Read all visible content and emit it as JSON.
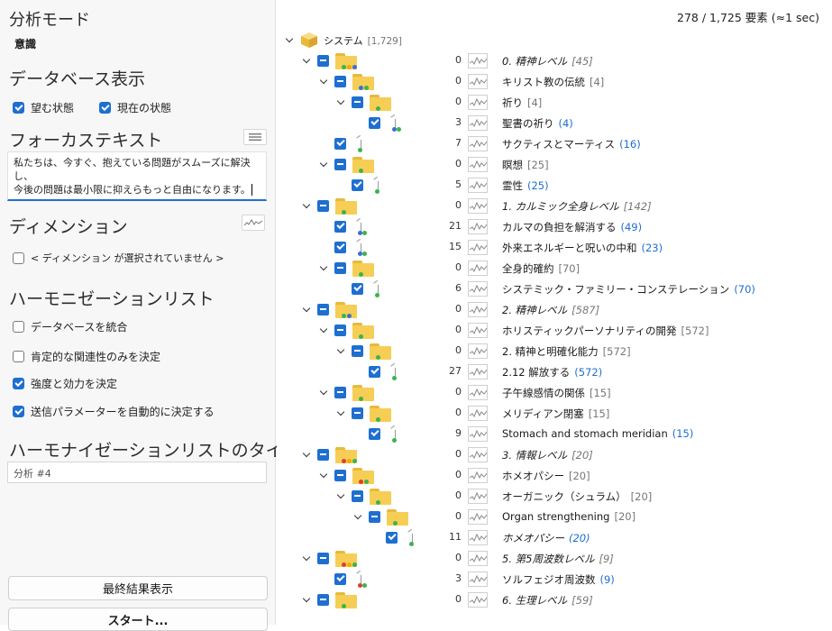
{
  "status": "278 / 1,725 要素 (≈1 sec)",
  "left": {
    "analysis_mode_title": "分析モード",
    "analysis_mode_value": "意識",
    "db_display_title": "データベース表示",
    "desired_state": "望む状態",
    "current_state": "現在の状態",
    "focus_text_title": "フォーカステキスト",
    "focus_text_line1": "私たちは、今すぐ、抱えている問題がスムーズに解決し、",
    "focus_text_line2": "今後の問題は最小限に抑えらもっと自由になります。",
    "dimension_title": "ディメンション",
    "dimension_none": "< ディメンション が選択されていません >",
    "harmonization_title": "ハーモニゼーションリスト",
    "opt_integrate": "データベースを統合",
    "opt_positive_only": "肯定的な関連性のみを決定",
    "opt_strength": "強度と効力を決定",
    "opt_auto_params": "送信パラメーターを自動的に決定する",
    "list_title_label": "ハーモナイゼーションリストのタイトル",
    "list_title_value": "分析 #4",
    "show_results_button": "最終結果表示",
    "start_button": "スタート..."
  },
  "tree": {
    "rows": [
      {
        "label": "システム",
        "count": "[1,729]",
        "num": "",
        "type": "root"
      },
      {
        "label": "0. 精神レベル",
        "count": "[45]",
        "num": "0",
        "italic": true
      },
      {
        "label": "キリスト教の伝統",
        "count": "[4]",
        "num": "0"
      },
      {
        "label": "祈り",
        "count": "[4]",
        "num": "0"
      },
      {
        "label": "聖書の祈り",
        "count": "(4)",
        "num": "3"
      },
      {
        "label": "サクティスとマーティス",
        "count": "(16)",
        "num": "7"
      },
      {
        "label": "瞑想",
        "count": "[25]",
        "num": "0"
      },
      {
        "label": "霊性",
        "count": "(25)",
        "num": "5"
      },
      {
        "label": "1. カルミック全身レベル",
        "count": "[142]",
        "num": "0",
        "italic": true
      },
      {
        "label": "カルマの負担を解消する",
        "count": "(49)",
        "num": "21"
      },
      {
        "label": "外来エネルギーと呪いの中和",
        "count": "(23)",
        "num": "15"
      },
      {
        "label": "全身的確約",
        "count": "[70]",
        "num": "0"
      },
      {
        "label": "システミック・ファミリー・コンステレーション",
        "count": "(70)",
        "num": "6"
      },
      {
        "label": "2. 精神レベル",
        "count": "[587]",
        "num": "0",
        "italic": true
      },
      {
        "label": "ホリスティックパーソナリティの開発",
        "count": "[572]",
        "num": "0"
      },
      {
        "label": "2. 精神と明確化能力",
        "count": "[572]",
        "num": "0"
      },
      {
        "label": "2.12 解放する",
        "count": "(572)",
        "num": "27"
      },
      {
        "label": "子午線感情の関係",
        "count": "[15]",
        "num": "0"
      },
      {
        "label": "メリディアン閉塞",
        "count": "[15]",
        "num": "0"
      },
      {
        "label": "Stomach and stomach meridian",
        "count": "(15)",
        "num": "9"
      },
      {
        "label": "3. 情報レベル",
        "count": "[20]",
        "num": "0",
        "italic": true
      },
      {
        "label": "ホメオパシー",
        "count": "[20]",
        "num": "0"
      },
      {
        "label": "オーガニック（シュラム）",
        "count": "[20]",
        "num": "0"
      },
      {
        "label": "Organ strengthening",
        "count": "[20]",
        "num": "0"
      },
      {
        "label": "ホメオパシー",
        "count": "(20)",
        "num": "11",
        "italic": true
      },
      {
        "label": "5. 第5周波数レベル",
        "count": "[9]",
        "num": "0",
        "italic": true
      },
      {
        "label": "ソルフェジオ周波数",
        "count": "(9)",
        "num": "3"
      },
      {
        "label": "6. 生理レベル",
        "count": "[59]",
        "num": "0",
        "italic": true
      }
    ]
  },
  "colors": {
    "accent": "#1e6fd0",
    "folder": "#f6ce55"
  }
}
